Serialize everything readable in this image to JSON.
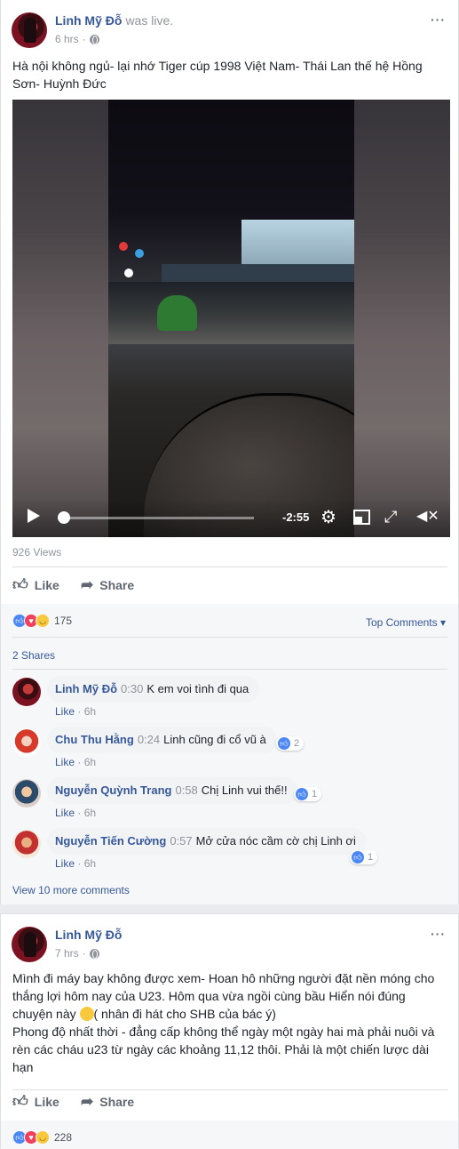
{
  "post1": {
    "author": "Linh Mỹ Đỗ",
    "status": "was live.",
    "time": "6 hrs",
    "more_icon": "···",
    "text_line1": "Hà nội không ngủ- lại nhớ Tiger cúp 1998 Việt Nam- Thái Lan thế hệ Hồng",
    "text_line2": "Sơn- Huỳnh Đức",
    "video": {
      "remaining": "-2:55",
      "progress": 0.0,
      "icons": [
        "play-icon",
        "settings-icon",
        "picture-in-picture-icon",
        "fullscreen-icon",
        "mute-icon"
      ]
    },
    "views": "926 Views",
    "like_label": "Like",
    "share_label": "Share",
    "reactions_count": "175",
    "top_comments": "Top Comments ▾",
    "shares": "2 Shares",
    "comments": [
      {
        "name": "Linh Mỹ Đỗ",
        "ts": "0:30",
        "text": "K em voi tình đi qua",
        "like": "Like",
        "age": "6h",
        "likes": ""
      },
      {
        "name": "Chu Thu Hằng",
        "ts": "0:24",
        "text": "Linh cũng đi cổ vũ à",
        "like": "Like",
        "age": "6h",
        "likes": "2"
      },
      {
        "name": "Nguyễn Quỳnh Trang",
        "ts": "0:58",
        "text": "Chị Linh vui thế!!",
        "like": "Like",
        "age": "6h",
        "likes": "1"
      },
      {
        "name": "Nguyễn Tiến Cường",
        "ts": "0:57",
        "text": "Mở cửa nóc cầm cờ chị Linh ơi",
        "like": "Like",
        "age": "6h",
        "likes": "1"
      }
    ],
    "view_more": "View 10 more comments"
  },
  "post2": {
    "author": "Linh Mỹ Đỗ",
    "time": "7 hrs",
    "more_icon": "···",
    "lines": [
      "Mình đi máy bay không được xem- Hoan hô những người đặt nền móng cho",
      "thắng lợi hôm nay của U23. Hôm qua vừa ngồi cùng bầu Hiển nói đúng",
      "( nhân đi hát cho SHB của bác ý)",
      "Phong độ nhất thời - đẳng cấp không thể ngày một ngày hai mà phải nuôi và",
      "rèn các cháu u23 từ ngày các khoảng 11,12 thôi. Phải là một chiến lược dài",
      "hạn"
    ],
    "line3_prefix": "chuyện này ",
    "like_label": "Like",
    "share_label": "Share",
    "reactions_count": "228"
  }
}
